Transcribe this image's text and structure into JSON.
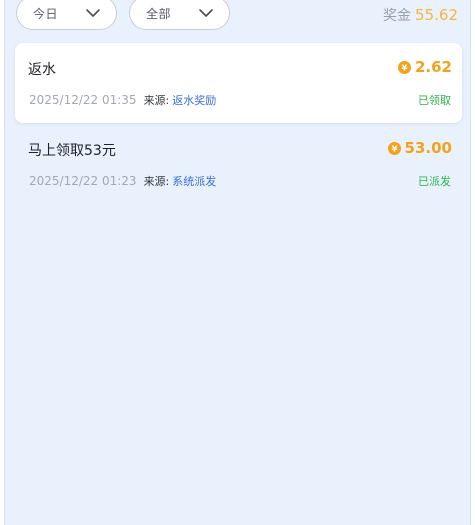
{
  "filters": {
    "date": "今日",
    "type": "全部"
  },
  "bonus": {
    "label": "奖金",
    "value": "55.62"
  },
  "records": [
    {
      "title": "返水",
      "amount": "2.62",
      "time": "2025/12/22 01:35",
      "source_label": "来源:",
      "source": "返水奖励",
      "status": "已领取"
    },
    {
      "title": "马上领取53元",
      "amount": "53.00",
      "time": "2025/12/22 01:23",
      "source_label": "来源:",
      "source": "系统派发",
      "status": "已派发"
    }
  ],
  "colors": {
    "background": "#e9f1fd",
    "accent_amount": "#f4a21b",
    "bonus_value": "#f5b73a",
    "source_link": "#3a6fd8",
    "status_green": "#2fb34a"
  },
  "icons": {
    "dropdown": "chevron-down-icon",
    "coin": "coin-icon"
  }
}
